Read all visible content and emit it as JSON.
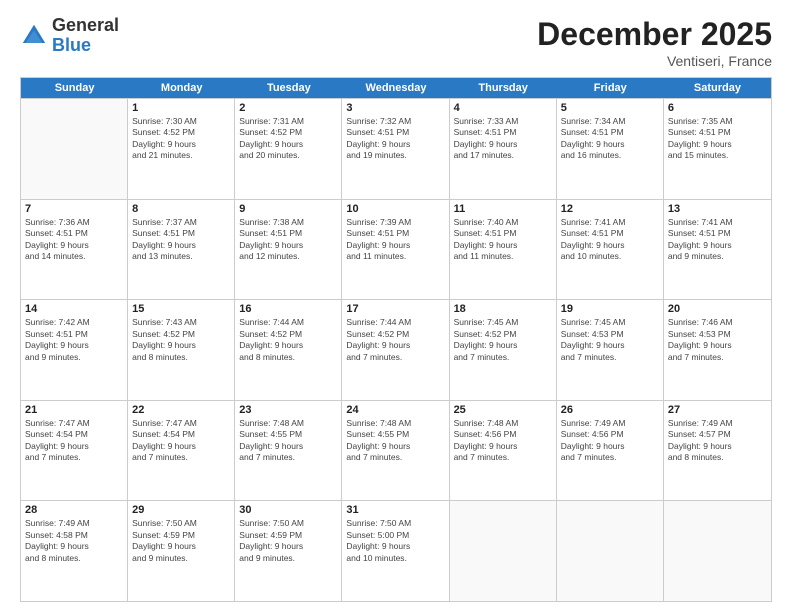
{
  "logo": {
    "general": "General",
    "blue": "Blue"
  },
  "title": "December 2025",
  "location": "Ventiseri, France",
  "days_of_week": [
    "Sunday",
    "Monday",
    "Tuesday",
    "Wednesday",
    "Thursday",
    "Friday",
    "Saturday"
  ],
  "weeks": [
    [
      {
        "day": "",
        "info": ""
      },
      {
        "day": "1",
        "info": "Sunrise: 7:30 AM\nSunset: 4:52 PM\nDaylight: 9 hours\nand 21 minutes."
      },
      {
        "day": "2",
        "info": "Sunrise: 7:31 AM\nSunset: 4:52 PM\nDaylight: 9 hours\nand 20 minutes."
      },
      {
        "day": "3",
        "info": "Sunrise: 7:32 AM\nSunset: 4:51 PM\nDaylight: 9 hours\nand 19 minutes."
      },
      {
        "day": "4",
        "info": "Sunrise: 7:33 AM\nSunset: 4:51 PM\nDaylight: 9 hours\nand 17 minutes."
      },
      {
        "day": "5",
        "info": "Sunrise: 7:34 AM\nSunset: 4:51 PM\nDaylight: 9 hours\nand 16 minutes."
      },
      {
        "day": "6",
        "info": "Sunrise: 7:35 AM\nSunset: 4:51 PM\nDaylight: 9 hours\nand 15 minutes."
      }
    ],
    [
      {
        "day": "7",
        "info": "Sunrise: 7:36 AM\nSunset: 4:51 PM\nDaylight: 9 hours\nand 14 minutes."
      },
      {
        "day": "8",
        "info": "Sunrise: 7:37 AM\nSunset: 4:51 PM\nDaylight: 9 hours\nand 13 minutes."
      },
      {
        "day": "9",
        "info": "Sunrise: 7:38 AM\nSunset: 4:51 PM\nDaylight: 9 hours\nand 12 minutes."
      },
      {
        "day": "10",
        "info": "Sunrise: 7:39 AM\nSunset: 4:51 PM\nDaylight: 9 hours\nand 11 minutes."
      },
      {
        "day": "11",
        "info": "Sunrise: 7:40 AM\nSunset: 4:51 PM\nDaylight: 9 hours\nand 11 minutes."
      },
      {
        "day": "12",
        "info": "Sunrise: 7:41 AM\nSunset: 4:51 PM\nDaylight: 9 hours\nand 10 minutes."
      },
      {
        "day": "13",
        "info": "Sunrise: 7:41 AM\nSunset: 4:51 PM\nDaylight: 9 hours\nand 9 minutes."
      }
    ],
    [
      {
        "day": "14",
        "info": "Sunrise: 7:42 AM\nSunset: 4:51 PM\nDaylight: 9 hours\nand 9 minutes."
      },
      {
        "day": "15",
        "info": "Sunrise: 7:43 AM\nSunset: 4:52 PM\nDaylight: 9 hours\nand 8 minutes."
      },
      {
        "day": "16",
        "info": "Sunrise: 7:44 AM\nSunset: 4:52 PM\nDaylight: 9 hours\nand 8 minutes."
      },
      {
        "day": "17",
        "info": "Sunrise: 7:44 AM\nSunset: 4:52 PM\nDaylight: 9 hours\nand 7 minutes."
      },
      {
        "day": "18",
        "info": "Sunrise: 7:45 AM\nSunset: 4:52 PM\nDaylight: 9 hours\nand 7 minutes."
      },
      {
        "day": "19",
        "info": "Sunrise: 7:45 AM\nSunset: 4:53 PM\nDaylight: 9 hours\nand 7 minutes."
      },
      {
        "day": "20",
        "info": "Sunrise: 7:46 AM\nSunset: 4:53 PM\nDaylight: 9 hours\nand 7 minutes."
      }
    ],
    [
      {
        "day": "21",
        "info": "Sunrise: 7:47 AM\nSunset: 4:54 PM\nDaylight: 9 hours\nand 7 minutes."
      },
      {
        "day": "22",
        "info": "Sunrise: 7:47 AM\nSunset: 4:54 PM\nDaylight: 9 hours\nand 7 minutes."
      },
      {
        "day": "23",
        "info": "Sunrise: 7:48 AM\nSunset: 4:55 PM\nDaylight: 9 hours\nand 7 minutes."
      },
      {
        "day": "24",
        "info": "Sunrise: 7:48 AM\nSunset: 4:55 PM\nDaylight: 9 hours\nand 7 minutes."
      },
      {
        "day": "25",
        "info": "Sunrise: 7:48 AM\nSunset: 4:56 PM\nDaylight: 9 hours\nand 7 minutes."
      },
      {
        "day": "26",
        "info": "Sunrise: 7:49 AM\nSunset: 4:56 PM\nDaylight: 9 hours\nand 7 minutes."
      },
      {
        "day": "27",
        "info": "Sunrise: 7:49 AM\nSunset: 4:57 PM\nDaylight: 9 hours\nand 8 minutes."
      }
    ],
    [
      {
        "day": "28",
        "info": "Sunrise: 7:49 AM\nSunset: 4:58 PM\nDaylight: 9 hours\nand 8 minutes."
      },
      {
        "day": "29",
        "info": "Sunrise: 7:50 AM\nSunset: 4:59 PM\nDaylight: 9 hours\nand 9 minutes."
      },
      {
        "day": "30",
        "info": "Sunrise: 7:50 AM\nSunset: 4:59 PM\nDaylight: 9 hours\nand 9 minutes."
      },
      {
        "day": "31",
        "info": "Sunrise: 7:50 AM\nSunset: 5:00 PM\nDaylight: 9 hours\nand 10 minutes."
      },
      {
        "day": "",
        "info": ""
      },
      {
        "day": "",
        "info": ""
      },
      {
        "day": "",
        "info": ""
      }
    ]
  ]
}
